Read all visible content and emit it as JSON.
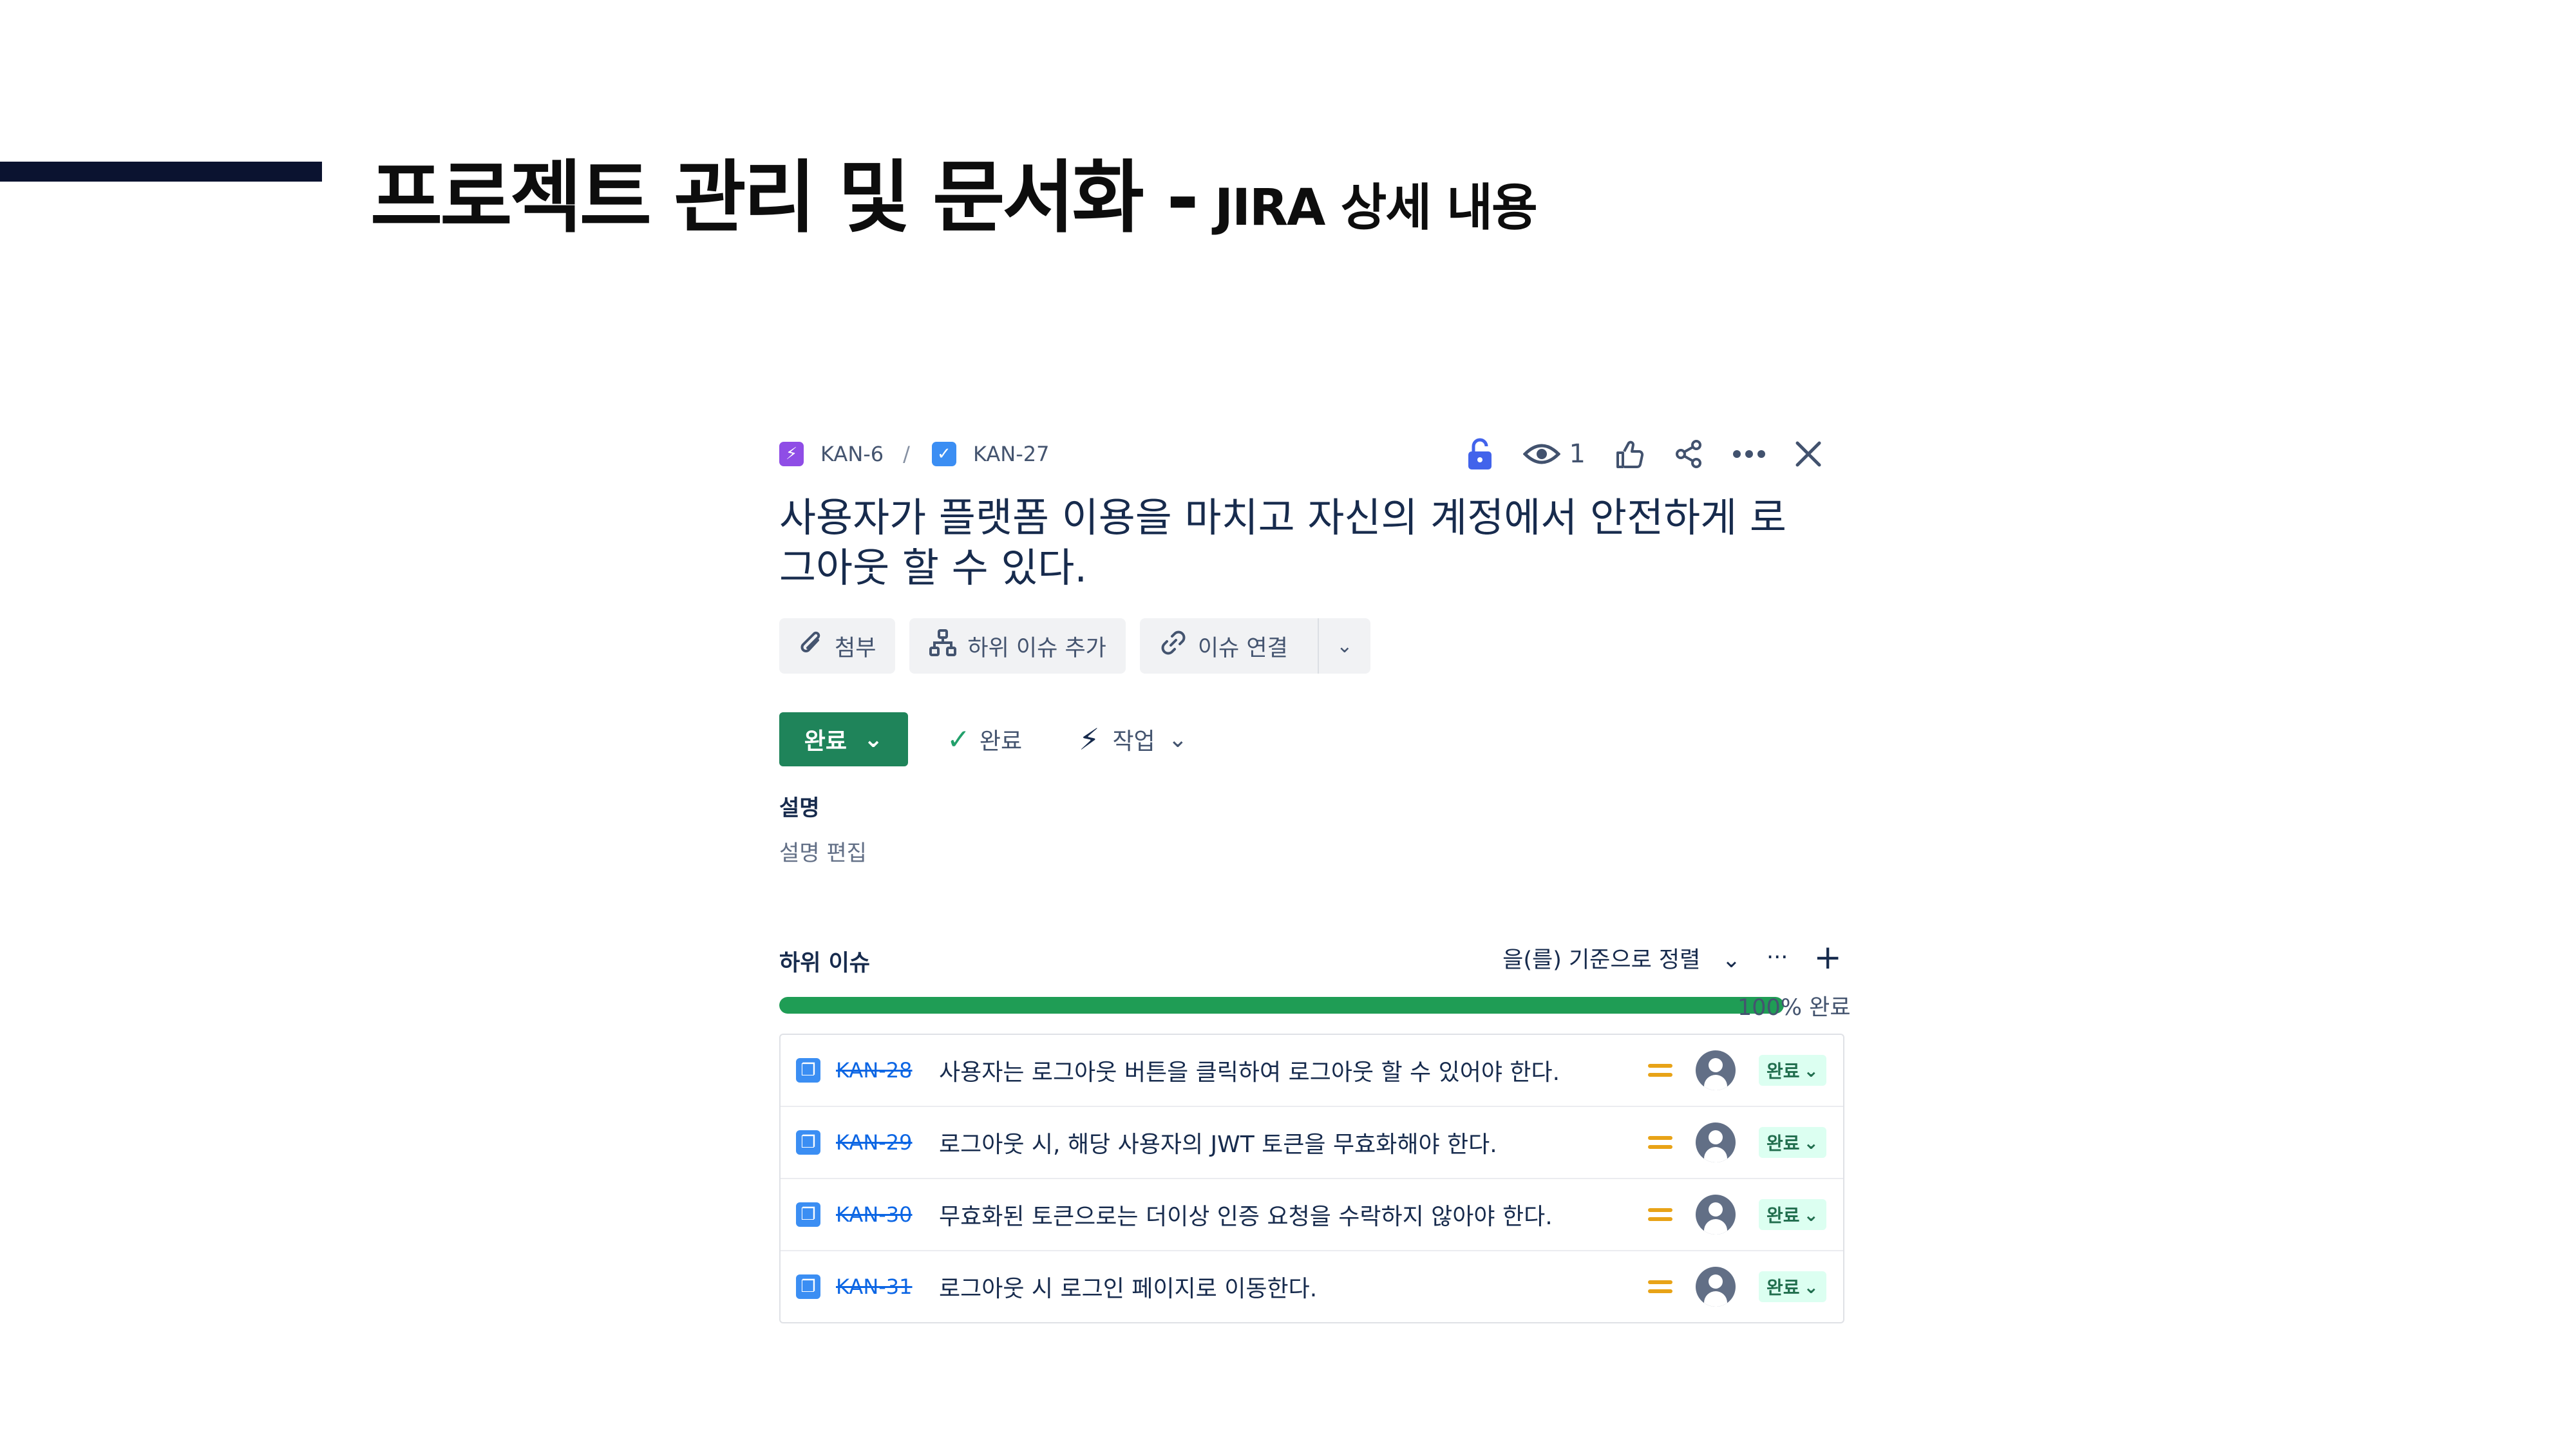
{
  "slide": {
    "title": "프로젝트 관리 및 문서화 -",
    "subtitle": "JIRA 상세 내용"
  },
  "breadcrumb": {
    "parent_key": "KAN-6",
    "separator": "/",
    "current_key": "KAN-27"
  },
  "toolbar": {
    "watch_count": "1"
  },
  "issue": {
    "title": "사용자가 플랫폼 이용을 마치고 자신의 계정에서 안전하게 로그아웃 할 수 있다.",
    "actions": {
      "attach": "첨부",
      "add_child": "하위 이슈 추가",
      "link_issue": "이슈 연결"
    },
    "status": "완료",
    "resolution": "완료",
    "type": "작업",
    "description_label": "설명",
    "description_placeholder": "설명 편집"
  },
  "child_issues": {
    "title": "하위 이슈",
    "sort_label": "을(를) 기준으로 정렬",
    "progress_percent": 100,
    "progress_label": "100% 완료",
    "items": [
      {
        "key": "KAN-28",
        "summary": "사용자는 로그아웃 버튼을 클릭하여 로그아웃 할 수 있어야 한다.",
        "status": "완료",
        "priority": "medium"
      },
      {
        "key": "KAN-29",
        "summary": "로그아웃 시, 해당 사용자의 JWT 토큰을 무효화해야 한다.",
        "status": "완료",
        "priority": "medium"
      },
      {
        "key": "KAN-30",
        "summary": "무효화된 토큰으로는 더이상 인증 요청을 수락하지 않아야 한다.",
        "status": "완료",
        "priority": "medium"
      },
      {
        "key": "KAN-31",
        "summary": "로그아웃 시 로그인 페이지로 이동한다.",
        "status": "완료",
        "priority": "medium"
      }
    ]
  },
  "colors": {
    "status_done": "#1f845a",
    "progress_fill": "#1f9d55",
    "link": "#0c66e4",
    "priority_medium": "#e8a317",
    "slide_bar": "#0b1330"
  }
}
